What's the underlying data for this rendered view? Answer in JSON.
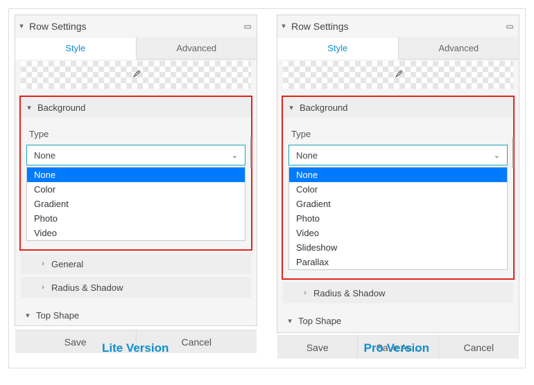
{
  "left": {
    "header": {
      "title": "Row Settings"
    },
    "tabs": {
      "style": "Style",
      "advanced": "Advanced"
    },
    "background": {
      "label": "Background",
      "type_label": "Type",
      "selected": "None",
      "options": [
        "None",
        "Color",
        "Gradient",
        "Photo",
        "Video"
      ]
    },
    "sections": {
      "general": "General",
      "radius_shadow": "Radius & Shadow"
    },
    "top_shape": "Top Shape",
    "buttons": {
      "save": "Save",
      "cancel": "Cancel"
    },
    "caption": "Lite Version"
  },
  "right": {
    "header": {
      "title": "Row Settings"
    },
    "tabs": {
      "style": "Style",
      "advanced": "Advanced"
    },
    "background": {
      "label": "Background",
      "type_label": "Type",
      "selected": "None",
      "options": [
        "None",
        "Color",
        "Gradient",
        "Photo",
        "Video",
        "Slideshow",
        "Parallax"
      ]
    },
    "sections": {
      "radius_shadow": "Radius & Shadow"
    },
    "top_shape": "Top Shape",
    "buttons": {
      "save": "Save",
      "save_as": "Save As...",
      "cancel": "Cancel"
    },
    "caption": "Pro Version"
  }
}
